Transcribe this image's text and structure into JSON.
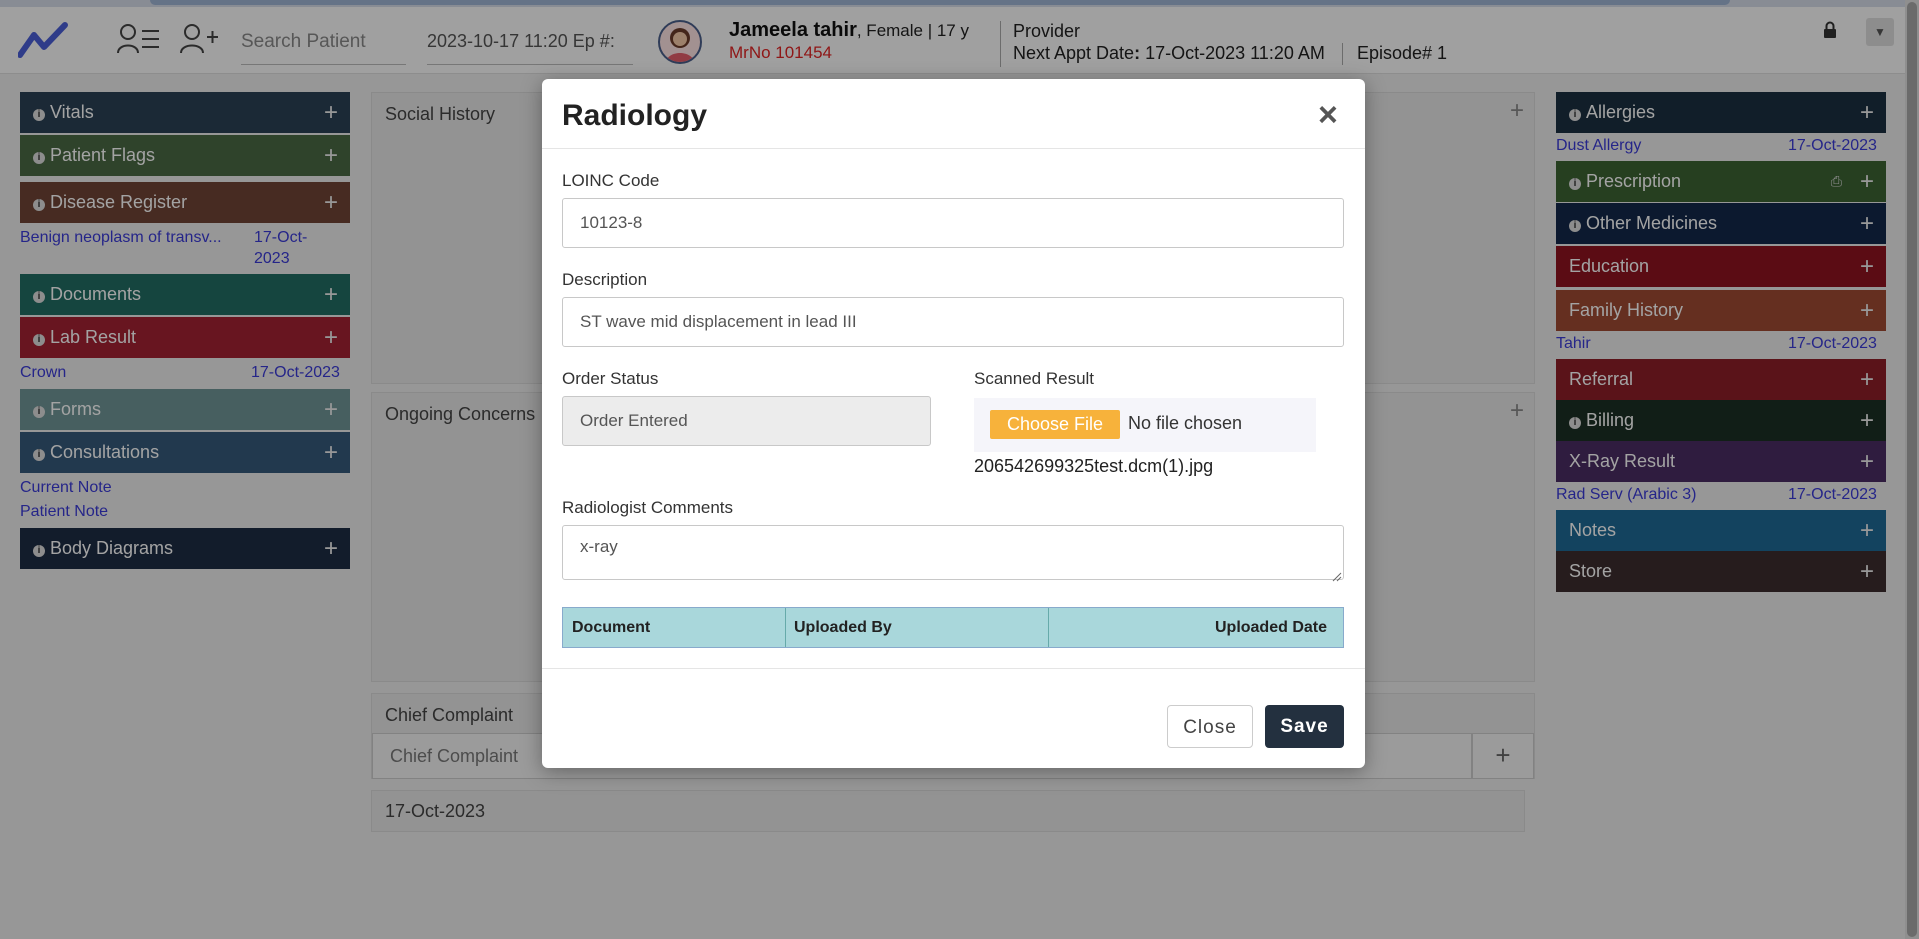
{
  "header": {
    "search_placeholder": "Search Patient",
    "datetime_episode": "2023-10-17 11:20 Ep #:",
    "patient_name": "Jameela tahir",
    "patient_info": ", Female | 17 y",
    "mrno": "MrNo 101454",
    "provider": "Provider",
    "next_appt_label": "Next Appt Date",
    "next_appt_value": "17-Oct-2023 11:20 AM",
    "episode": "Episode# 1"
  },
  "left_panels": [
    {
      "label": "Vitals",
      "color": "#2b4155"
    },
    {
      "label": "Patient Flags",
      "color": "#4a6a44"
    },
    {
      "label": "Disease Register",
      "color": "#6f4436"
    },
    {
      "label": "Documents",
      "color": "#226d63"
    },
    {
      "label": "Lab Result",
      "color": "#a32233"
    },
    {
      "label": "Forms",
      "color": "#6f9596"
    },
    {
      "label": "Consultations",
      "color": "#365a7b"
    },
    {
      "label": "Body Diagrams",
      "color": "#1d2d44"
    }
  ],
  "left_links": {
    "disease_item": "Benign neoplasm of transv...",
    "disease_date_1": "17-Oct-",
    "disease_date_2": "2023",
    "lab_item": "Crown",
    "lab_date": "17-Oct-2023",
    "consult_1": "Current Note",
    "consult_2": "Patient Note"
  },
  "middle": {
    "social_history": "Social History",
    "ongoing_concerns": "Ongoing Concerns",
    "chief_complaint": "Chief Complaint",
    "chief_complaint_placeholder": "Chief Complaint",
    "date": "17-Oct-2023"
  },
  "right_panels": [
    {
      "label": "Allergies",
      "color": "#1b3040",
      "info": true
    },
    {
      "label": "Prescription",
      "color": "#3c6333",
      "info": true
    },
    {
      "label": "Other Medicines",
      "color": "#13284a",
      "info": true
    },
    {
      "label": "Education",
      "color": "#8f1420",
      "info": false
    },
    {
      "label": "Family History",
      "color": "#9e4a33",
      "info": false
    },
    {
      "label": "Referral",
      "color": "#8d1e28",
      "info": false
    },
    {
      "label": "Billing",
      "color": "#1c3024",
      "info": true
    },
    {
      "label": "X-Ray Result",
      "color": "#4a2d63",
      "info": false
    },
    {
      "label": "Notes",
      "color": "#1e6a95",
      "info": false
    },
    {
      "label": "Store",
      "color": "#3c2c2e",
      "info": false
    }
  ],
  "right_links": {
    "allergy_item": "Dust Allergy",
    "allergy_date": "17-Oct-2023",
    "family_item": "Tahir",
    "family_date": "17-Oct-2023",
    "xray_item": "Rad Serv (Arabic 3)",
    "xray_date": "17-Oct-2023"
  },
  "modal": {
    "title": "Radiology",
    "close_symbol": "×",
    "loinc_label": "LOINC Code",
    "loinc_value": "10123-8",
    "description_label": "Description",
    "description_value": "ST wave mid displacement in lead III",
    "order_status_label": "Order Status",
    "order_status_value": "Order Entered",
    "scanned_result_label": "Scanned Result",
    "choose_file": "Choose File",
    "no_file": "No file chosen",
    "file_name": "206542699325test.dcm(1).jpg",
    "comments_label": "Radiologist Comments",
    "comments_value": "x-ray",
    "table_headers": [
      "Document",
      "Uploaded By",
      "Uploaded Date"
    ],
    "close_button": "Close",
    "save_button": "Save"
  }
}
